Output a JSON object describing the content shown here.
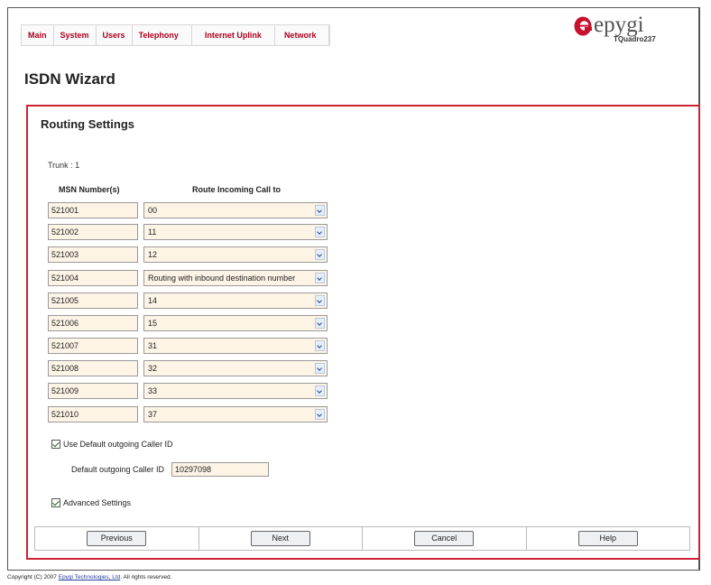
{
  "nav": [
    "Main",
    "System",
    "Users",
    "Telephony",
    "Internet Uplink",
    "Network"
  ],
  "logo": {
    "text": "epygi",
    "model": "TQuadro237"
  },
  "page_title": "ISDN Wizard",
  "section_title": "Routing Settings",
  "trunk_label": "Trunk :  1",
  "columns": {
    "msn": "MSN Number(s)",
    "route": "Route Incoming Call to"
  },
  "rows": [
    {
      "msn": "521001",
      "route": "00"
    },
    {
      "msn": "521002",
      "route": "11"
    },
    {
      "msn": "521003",
      "route": "12"
    },
    {
      "msn": "521004",
      "route": "Routing with inbound destination number"
    },
    {
      "msn": "521005",
      "route": "14"
    },
    {
      "msn": "521006",
      "route": "15"
    },
    {
      "msn": "521007",
      "route": "31"
    },
    {
      "msn": "521008",
      "route": "32"
    },
    {
      "msn": "521009",
      "route": "33"
    },
    {
      "msn": "521010",
      "route": "37"
    }
  ],
  "use_default_caller_id": {
    "label": "Use Default outgoing Caller ID",
    "checked": true
  },
  "default_caller_id": {
    "label": "Default outgoing Caller ID",
    "value": "10297098"
  },
  "advanced_settings": {
    "label": "Advanced Settings",
    "checked": true
  },
  "buttons": {
    "previous": "Previous",
    "next": "Next",
    "cancel": "Cancel",
    "help": "Help"
  },
  "footer": {
    "prefix": "Copyright (C) 2007 ",
    "link": "Epygi Technologies, Ltd",
    "suffix": ". All rights reserved."
  },
  "colors": {
    "nav_text": "#b0001e",
    "panel_border": "#cc2233",
    "input_bg": "#fdf4e6",
    "logo_red": "#c8102e"
  }
}
